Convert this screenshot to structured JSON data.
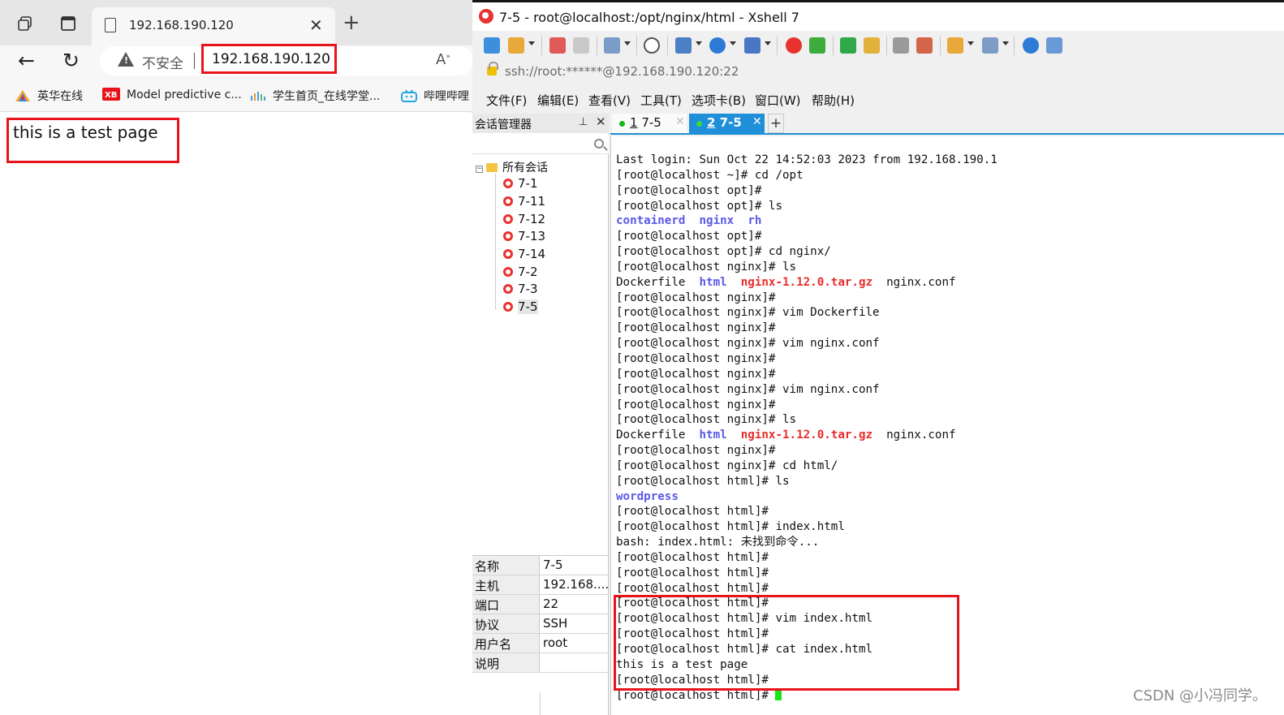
{
  "browser": {
    "tab_title": "192.168.190.120",
    "security_text": "不安全",
    "url": "192.168.190.120",
    "bookmarks": [
      "英华在线",
      "Model predictive c...",
      "学生首页_在线学堂...",
      "哔哩哔哩"
    ],
    "page_text": "this is a test page"
  },
  "xshell": {
    "title": "7-5 - root@localhost:/opt/nginx/html - Xshell 7",
    "address": "ssh://root:******@192.168.190.120:22",
    "menu": [
      "文件(F)",
      "编辑(E)",
      "查看(V)",
      "工具(T)",
      "选项卡(B)",
      "窗口(W)",
      "帮助(H)"
    ],
    "session_panel": {
      "title": "会话管理器",
      "root": "所有会话",
      "sessions": [
        "7-1",
        "7-11",
        "7-12",
        "7-13",
        "7-14",
        "7-2",
        "7-3",
        "7-5"
      ],
      "selected": "7-5"
    },
    "properties": [
      {
        "key": "名称",
        "value": "7-5"
      },
      {
        "key": "主机",
        "value": "192.168...."
      },
      {
        "key": "端口",
        "value": "22"
      },
      {
        "key": "协议",
        "value": "SSH"
      },
      {
        "key": "用户名",
        "value": "root"
      },
      {
        "key": "说明",
        "value": ""
      }
    ],
    "tabs": [
      {
        "number": "1",
        "label": "7-5"
      },
      {
        "number": "2",
        "label": "7-5"
      }
    ],
    "terminal_lines": [
      [
        {
          "t": "Last login: Sun Oct 22 14:52:03 2023 from 192.168.190.1"
        }
      ],
      [
        {
          "t": "[root@localhost ~]# cd /opt"
        }
      ],
      [
        {
          "t": "[root@localhost opt]#"
        }
      ],
      [
        {
          "t": "[root@localhost opt]# ls"
        }
      ],
      [
        {
          "t": "containerd",
          "c": "blue"
        },
        {
          "t": "  "
        },
        {
          "t": "nginx",
          "c": "blue"
        },
        {
          "t": "  "
        },
        {
          "t": "rh",
          "c": "blue"
        }
      ],
      [
        {
          "t": "[root@localhost opt]#"
        }
      ],
      [
        {
          "t": "[root@localhost opt]# cd nginx/"
        }
      ],
      [
        {
          "t": "[root@localhost nginx]# ls"
        }
      ],
      [
        {
          "t": "Dockerfile  "
        },
        {
          "t": "html",
          "c": "blue"
        },
        {
          "t": "  "
        },
        {
          "t": "nginx-1.12.0.tar.gz",
          "c": "red"
        },
        {
          "t": "  nginx.conf"
        }
      ],
      [
        {
          "t": "[root@localhost nginx]#"
        }
      ],
      [
        {
          "t": "[root@localhost nginx]# vim Dockerfile"
        }
      ],
      [
        {
          "t": "[root@localhost nginx]#"
        }
      ],
      [
        {
          "t": "[root@localhost nginx]# vim nginx.conf"
        }
      ],
      [
        {
          "t": "[root@localhost nginx]#"
        }
      ],
      [
        {
          "t": "[root@localhost nginx]#"
        }
      ],
      [
        {
          "t": "[root@localhost nginx]# vim nginx.conf"
        }
      ],
      [
        {
          "t": "[root@localhost nginx]#"
        }
      ],
      [
        {
          "t": "[root@localhost nginx]# ls"
        }
      ],
      [
        {
          "t": "Dockerfile  "
        },
        {
          "t": "html",
          "c": "blue"
        },
        {
          "t": "  "
        },
        {
          "t": "nginx-1.12.0.tar.gz",
          "c": "red"
        },
        {
          "t": "  nginx.conf"
        }
      ],
      [
        {
          "t": "[root@localhost nginx]#"
        }
      ],
      [
        {
          "t": "[root@localhost nginx]# cd html/"
        }
      ],
      [
        {
          "t": "[root@localhost html]# ls"
        }
      ],
      [
        {
          "t": "wordpress",
          "c": "blue"
        }
      ],
      [
        {
          "t": "[root@localhost html]#"
        }
      ],
      [
        {
          "t": "[root@localhost html]# index.html"
        }
      ],
      [
        {
          "t": "bash: index.html: 未找到命令..."
        }
      ],
      [
        {
          "t": "[root@localhost html]#"
        }
      ],
      [
        {
          "t": "[root@localhost html]#"
        }
      ],
      [
        {
          "t": "[root@localhost html]#"
        }
      ],
      [
        {
          "t": "[root@localhost html]#"
        }
      ],
      [
        {
          "t": "[root@localhost html]# vim index.html"
        }
      ],
      [
        {
          "t": "[root@localhost html]#"
        }
      ],
      [
        {
          "t": "[root@localhost html]# cat index.html"
        }
      ],
      [
        {
          "t": "this is a test page"
        }
      ],
      [
        {
          "t": "[root@localhost html]#"
        }
      ],
      [
        {
          "t": "[root@localhost html]# "
        },
        {
          "cursor": true
        }
      ]
    ],
    "colors": {
      "accent": "#1e8fd8",
      "highlight_box": "#e8141b",
      "cursor": "#19e619"
    }
  },
  "watermark": "CSDN @小冯同学。"
}
